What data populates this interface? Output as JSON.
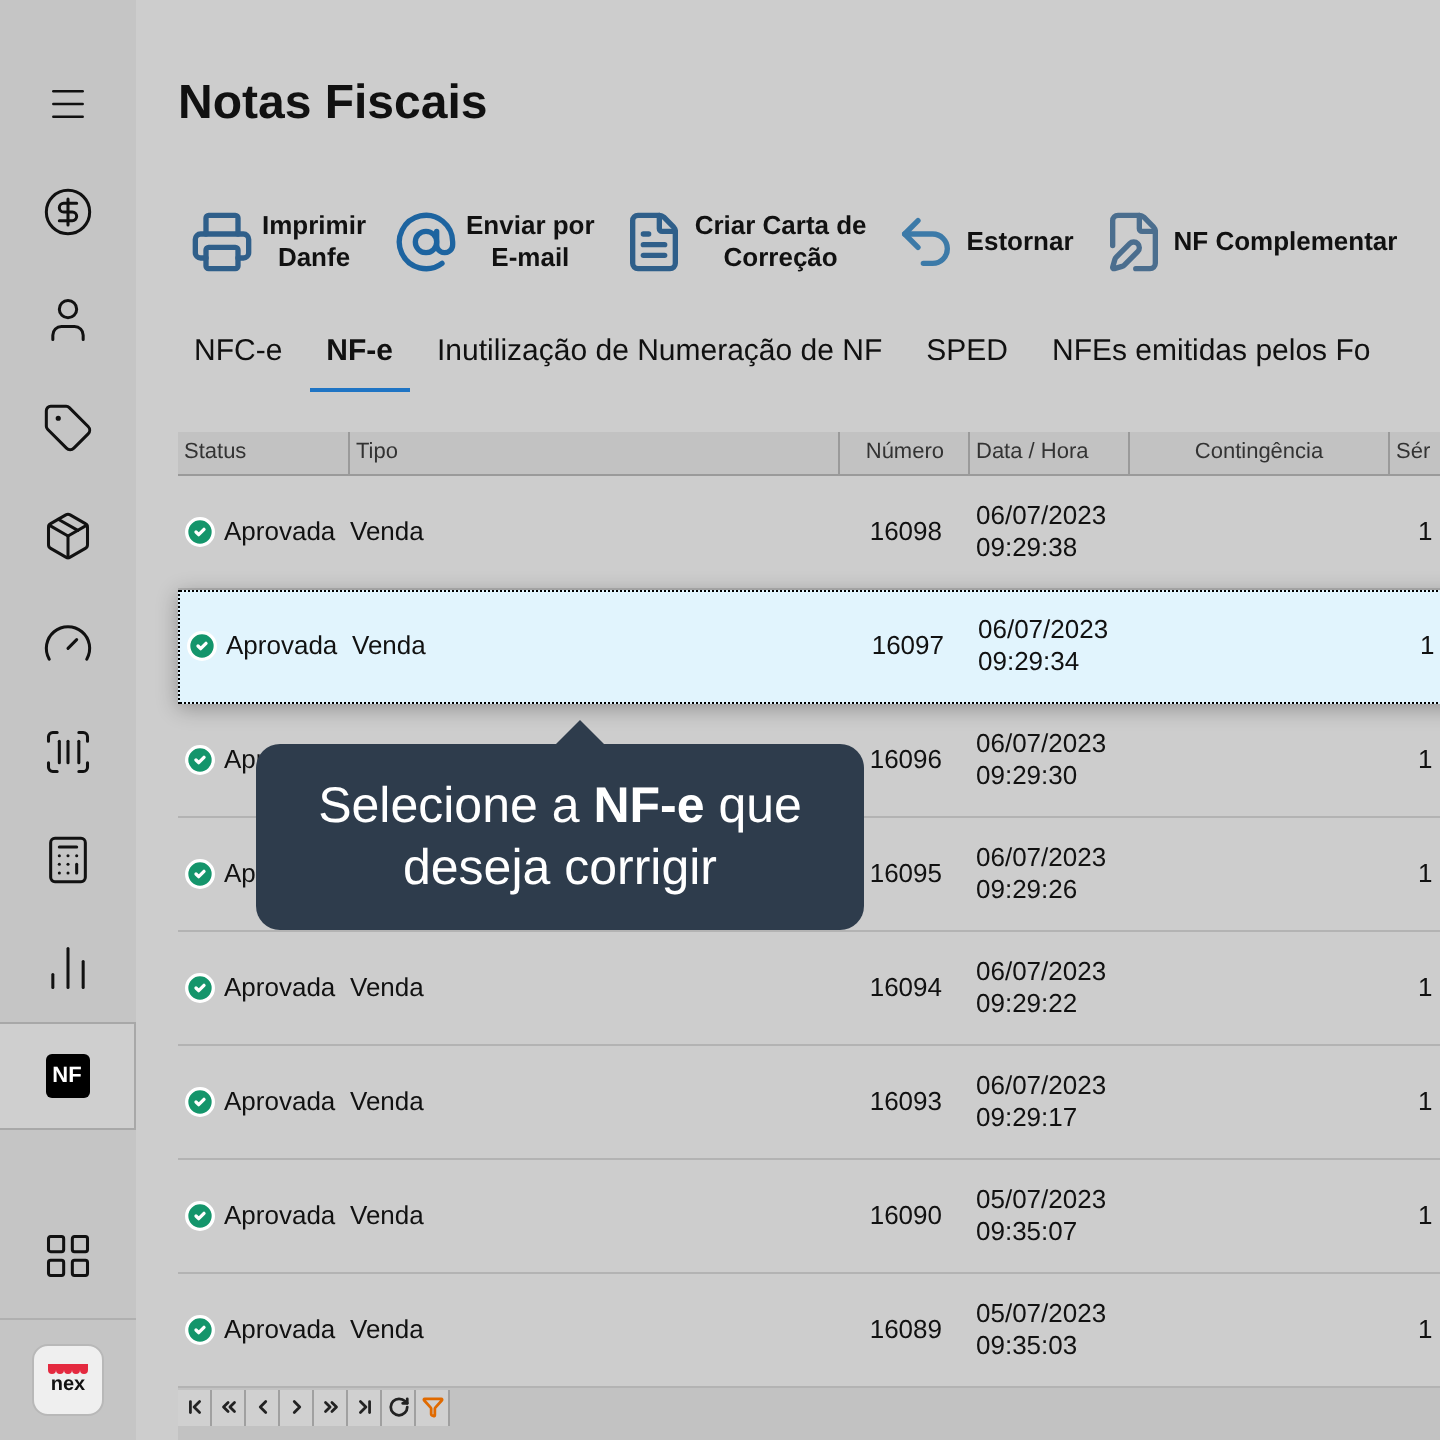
{
  "sidebar": {
    "items": [
      {
        "kind": "menu",
        "selected": false
      },
      {
        "kind": "dollar",
        "selected": false
      },
      {
        "kind": "user",
        "selected": false
      },
      {
        "kind": "tag",
        "selected": false
      },
      {
        "kind": "box",
        "selected": false
      },
      {
        "kind": "dial",
        "selected": false
      },
      {
        "kind": "barcode",
        "selected": false
      },
      {
        "kind": "register",
        "selected": false
      },
      {
        "kind": "chart",
        "selected": false
      },
      {
        "kind": "nf",
        "label": "NF",
        "selected": true
      },
      {
        "kind": "grid",
        "selected": false
      }
    ],
    "logo": "nex"
  },
  "title": "Notas Fiscais",
  "toolbar": [
    {
      "kind": "print",
      "label": "Imprimir\nDanfe"
    },
    {
      "kind": "email",
      "label": "Enviar por\nE-mail"
    },
    {
      "kind": "letter",
      "label": "Criar Carta de\nCorreção"
    },
    {
      "kind": "undo",
      "label": "Estornar"
    },
    {
      "kind": "complement",
      "label": "NF Complementar"
    }
  ],
  "tabs": [
    {
      "label": "NFC-e",
      "selected": false
    },
    {
      "label": "NF-e",
      "selected": true
    },
    {
      "label": "Inutilização de Numeração de NF",
      "selected": false
    },
    {
      "label": "SPED",
      "selected": false
    },
    {
      "label": "NFEs emitidas pelos Fo",
      "selected": false
    }
  ],
  "table": {
    "columns": [
      "Status",
      "Tipo",
      "Número",
      "Data / Hora",
      "Contingência",
      "Sér"
    ],
    "rows": [
      {
        "status": "Aprovada",
        "tipo": "Venda",
        "numero": "16098",
        "date": "06/07/2023",
        "time": "09:29:38",
        "column_6": "1",
        "selected": false
      },
      {
        "status": "Aprovada",
        "tipo": "Venda",
        "numero": "16097",
        "date": "06/07/2023",
        "time": "09:29:34",
        "column_6": "1",
        "selected": true
      },
      {
        "status": "Apr",
        "numero": "16096",
        "date": "06/07/2023",
        "time": "09:29:30",
        "column_6": "1",
        "selected": false
      },
      {
        "status": "Ap",
        "numero": "16095",
        "date": "06/07/2023",
        "time": "09:29:26",
        "column_6": "1",
        "selected": false
      },
      {
        "status": "Aprovada",
        "tipo": "Venda",
        "numero": "16094",
        "date": "06/07/2023",
        "time": "09:29:22",
        "column_6": "1",
        "selected": false
      },
      {
        "status": "Aprovada",
        "tipo": "Venda",
        "numero": "16093",
        "date": "06/07/2023",
        "time": "09:29:17",
        "column_6": "1",
        "selected": false
      },
      {
        "status": "Aprovada",
        "tipo": "Venda",
        "numero": "16090",
        "date": "05/07/2023",
        "time": "09:35:07",
        "column_6": "1",
        "selected": false
      },
      {
        "status": "Aprovada",
        "tipo": "Venda",
        "numero": "16089",
        "date": "05/07/2023",
        "time": "09:35:03",
        "column_6": "1",
        "selected": false
      }
    ]
  },
  "tooltip": "Selecione a **NF-e** que\ndeseja corrigir"
}
